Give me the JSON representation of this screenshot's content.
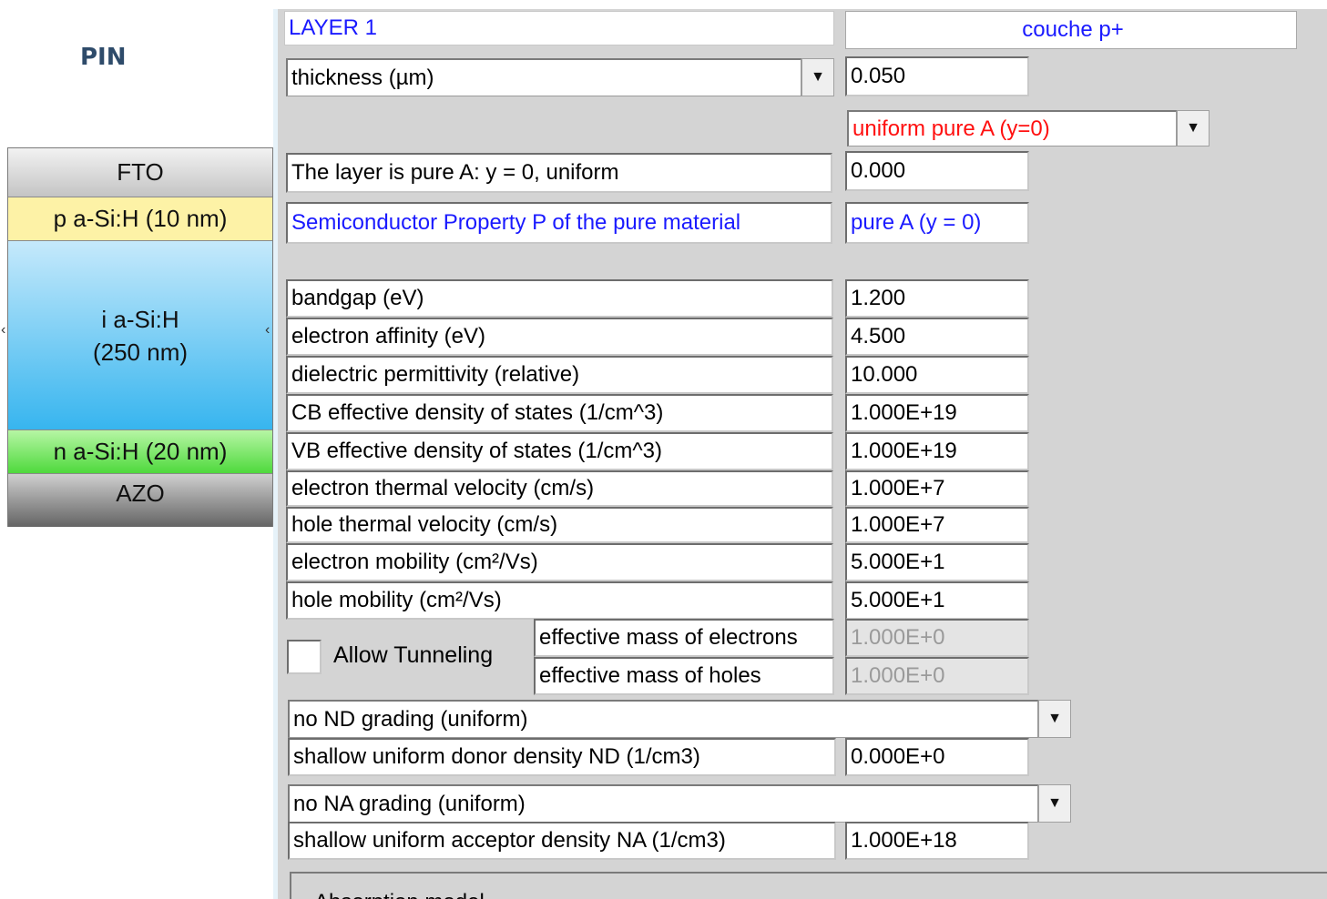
{
  "diagram": {
    "title": "PIN",
    "layers": [
      "FTO",
      "p a-Si:H (10 nm)",
      "i a-Si:H",
      "(250 nm)",
      "n a-Si:H (20 nm)",
      "AZO"
    ]
  },
  "layer": {
    "name": "LAYER 1",
    "description": "couche p+",
    "thickness_label": "thickness (µm)",
    "thickness_value": "0.050",
    "composition_select": "uniform pure A (y=0)",
    "composition_text": "The layer is pure A: y = 0, uniform",
    "composition_value": "0.000",
    "property_label": "Semiconductor Property P of the pure material",
    "property_value": "pure A (y = 0)"
  },
  "properties": [
    {
      "label": "bandgap (eV)",
      "value": "1.200"
    },
    {
      "label": "electron affinity (eV)",
      "value": "4.500"
    },
    {
      "label": "dielectric permittivity (relative)",
      "value": "10.000"
    },
    {
      "label": "CB effective density of states (1/cm^3)",
      "value": "1.000E+19"
    },
    {
      "label": "VB effective density of states (1/cm^3)",
      "value": "1.000E+19"
    },
    {
      "label": "electron thermal velocity (cm/s)",
      "value": "1.000E+7"
    },
    {
      "label": "hole thermal velocity (cm/s)",
      "value": "1.000E+7"
    },
    {
      "label": "electron mobility (cm²/Vs)",
      "value": "5.000E+1"
    },
    {
      "label": "hole mobility (cm²/Vs)",
      "value": "5.000E+1"
    }
  ],
  "tunneling": {
    "checkbox_label": "Allow Tunneling",
    "checked": false,
    "electron_mass_label": "effective mass of electrons",
    "electron_mass_value": "1.000E+0",
    "hole_mass_label": "effective mass of holes",
    "hole_mass_value": "1.000E+0"
  },
  "doping": {
    "nd_grading": "no ND grading (uniform)",
    "nd_label": "shallow uniform donor density ND (1/cm3)",
    "nd_value": "0.000E+0",
    "na_grading": "no NA grading (uniform)",
    "na_label": "shallow uniform acceptor density NA (1/cm3)",
    "na_value": "1.000E+18"
  },
  "absorption": {
    "label": "Absorption model"
  }
}
